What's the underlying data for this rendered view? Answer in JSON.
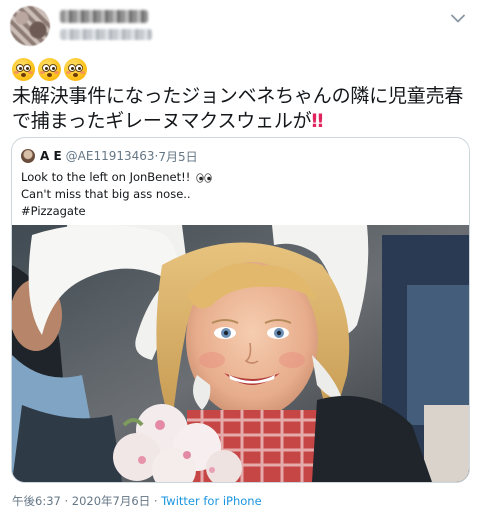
{
  "tweet": {
    "author_display_name": "",
    "author_handle": "",
    "text_line1": "未解決事件になったジョンベネちゃんの隣に児童売春",
    "text_line2": "で捕まったギレーヌマクスウェルが",
    "bangbang": "‼",
    "emojis": [
      "flushed-face",
      "flushed-face",
      "flushed-face"
    ],
    "timestamp": "午後6:37 · 2020年7月6日",
    "separator": " · ",
    "source": "Twitter for iPhone"
  },
  "quoted": {
    "name": "A E",
    "handle": "@AE11913463",
    "date": "7月5日",
    "line1": "Look to the left on JonBenet!!",
    "line2": "Can't miss that big ass nose..",
    "line3": "#Pizzagate",
    "icon": "eyes-icon"
  },
  "colors": {
    "link": "#1b95e0",
    "muted": "#657786",
    "border": "#ccd6dd",
    "bangbang": "#e0245e"
  }
}
